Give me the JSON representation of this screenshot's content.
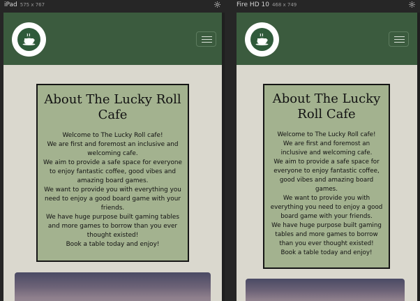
{
  "devices": [
    {
      "label": "iPad",
      "dims": "575 x 767",
      "icons": {
        "settings": "gear-icon",
        "menu": "hamburger-icon",
        "logo": "cafe-logo"
      },
      "about": {
        "title": "About The Lucky Roll Cafe",
        "lines": [
          "Welcome to The Lucky Roll cafe!",
          "We are first and foremost an inclusive and",
          "welcoming cafe.",
          "We aim to provide a safe space for everyone",
          "to enjoy fantastic coffee, good vibes and",
          "amazing board games.",
          "We want to provide you with everything you",
          "need to enjoy a good board game with your",
          "friends.",
          "We have huge purpose built gaming tables",
          "and more games to borrow than you ever",
          "thought existed!",
          "Book a table today and enjoy!"
        ]
      }
    },
    {
      "label": "Fire HD 10",
      "dims": "468 x 749",
      "icons": {
        "settings": "gear-icon",
        "menu": "hamburger-icon",
        "logo": "cafe-logo"
      },
      "about": {
        "title": "About The Lucky Roll Cafe",
        "lines": [
          "Welcome to The Lucky Roll cafe!",
          "We are first and foremost an",
          "inclusive and welcoming cafe.",
          "We aim to provide a safe space for",
          "everyone to enjoy fantastic coffee,",
          "good vibes and amazing board",
          "games.",
          "We want to provide you with",
          "everything you need to enjoy a good",
          "board game with your friends.",
          "We have huge purpose built gaming",
          "tables and more games to borrow",
          "than you ever thought existed!",
          "Book a table today and enjoy!"
        ]
      }
    }
  ],
  "colors": {
    "chrome": "#262626",
    "navbar": "#3b5b3e",
    "page_bg": "#dad8ce",
    "card_bg": "#a3b28f"
  }
}
